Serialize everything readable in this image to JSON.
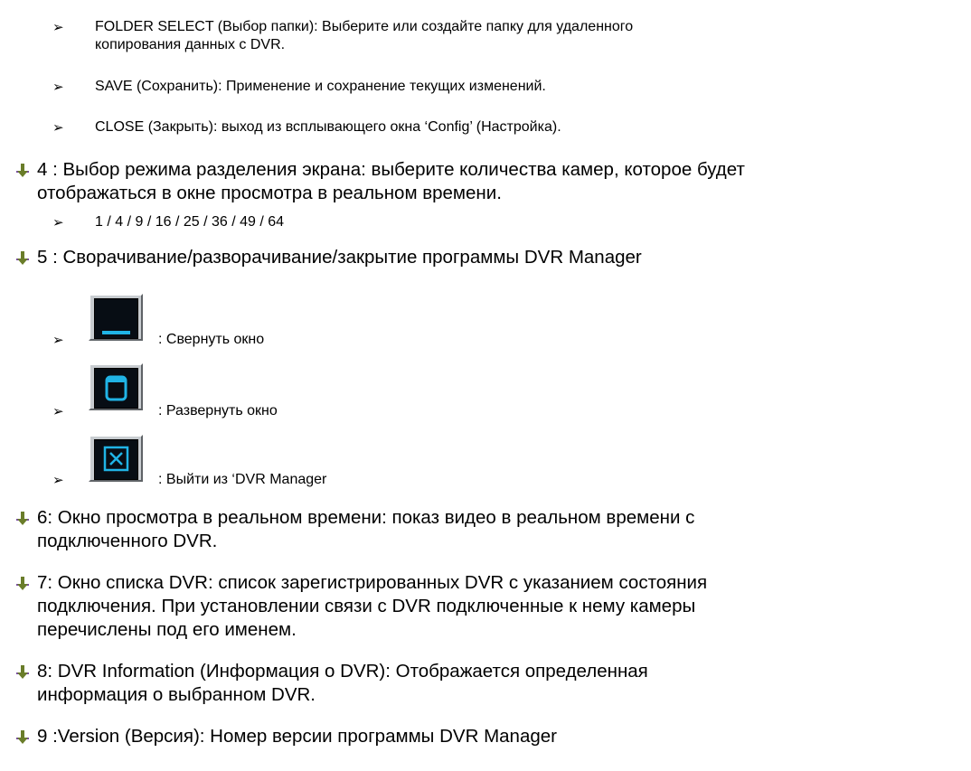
{
  "bullets": {
    "folder_select_line1": "FOLDER SELECT (Выбор папки): Выберите или создайте папку для удаленного",
    "folder_select_line2": "копирования данных с DVR.",
    "save": "SAVE (Сохранить): Применение и сохранение текущих изменений.",
    "close": "CLOSE (Закрыть): выход из всплывающего окна ‘Config’ (Настройка).",
    "screen_modes": "1 / 4 / 9 / 16 / 25 / 36 / 49 / 64",
    "minimize": ": Свернуть окно",
    "maximize": ": Развернуть окно",
    "exit": ": Выйти из ‘DVR Manager"
  },
  "items": {
    "item4_line1": "4 : Выбор режима разделения экрана: выберите количества камер, которое будет",
    "item4_line2": "отображаться в окне просмотра в реальном времени.",
    "item5": "5 : Сворачивание/разворачивание/закрытие программы DVR Manager",
    "item6_line1": "6: Окно просмотра в реальном времени: показ видео в реальном времени с",
    "item6_line2": "подключенного DVR.",
    "item7_line1": "7: Окно списка DVR: список зарегистрированных DVR с указанием состояния",
    "item7_line2": "подключения. При установлении связи с DVR подключенные к нему камеры",
    "item7_line3": "перечислены под его именем.",
    "item8_line1": "8: DVR Information (Информация о DVR): Отображается определенная",
    "item8_line2": "информация о выбранном DVR.",
    "item9": "9 :Version (Версия): Номер версии программы DVR Manager"
  },
  "symbols": {
    "arrow": "➢"
  },
  "colors": {
    "bullet_arrow": "#6a7d2a",
    "bullet_cross": "#7a4ba6",
    "icon_accent": "#20b4e6"
  }
}
